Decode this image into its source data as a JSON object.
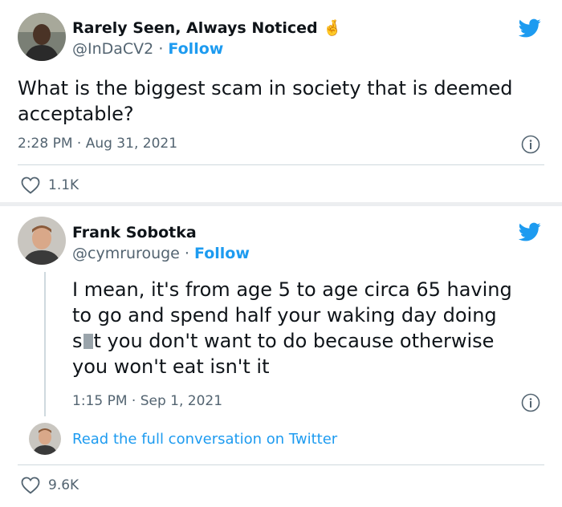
{
  "tweet1": {
    "display_name": "Rarely Seen, Always Noticed",
    "emoji": "🤞",
    "handle": "@InDaCV2",
    "follow_label": "Follow",
    "separator": "·",
    "text": "What is the biggest scam in society that is deemed acceptable?",
    "timestamp": "2:28 PM · Aug 31, 2021",
    "likes": "1.1K"
  },
  "tweet2": {
    "display_name": "Frank Sobotka",
    "handle": "@cymrurouge",
    "follow_label": "Follow",
    "separator": "·",
    "text_line1": "I mean, it's from age 5 to age circa 65 having",
    "text_line2": "to go and spend half your waking day doing",
    "text_line3_start": "s",
    "text_line3_end": "t you don't want to do because otherwise",
    "text_line4": "you won't eat isn't it",
    "timestamp": "1:15 PM · Sep 1, 2021",
    "read_more": "Read the full conversation on Twitter",
    "likes": "9.6K"
  },
  "colors": {
    "twitter_blue": "#1d9bf0",
    "muted_text": "#536471",
    "divider": "#cfd9de"
  },
  "icons": [
    "twitter-bird-icon",
    "info-icon",
    "heart-icon"
  ]
}
